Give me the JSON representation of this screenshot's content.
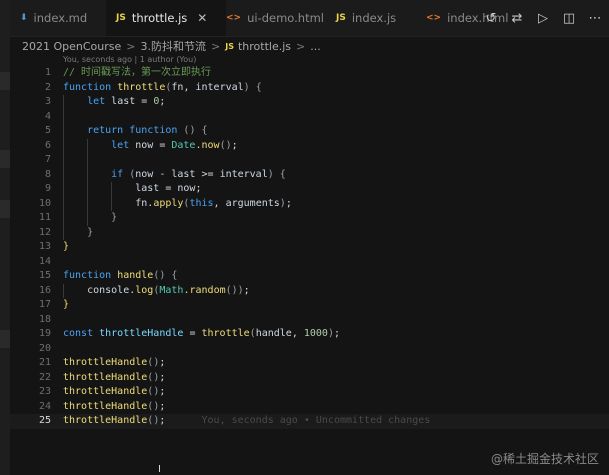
{
  "tabs": [
    {
      "icon": "markdown-icon",
      "glyph": "⬇",
      "label": "index.md",
      "active": false
    },
    {
      "icon": "js-file-icon",
      "glyph": "JS",
      "label": "throttle.js",
      "active": true
    },
    {
      "icon": "html-file-icon",
      "glyph": "<>",
      "label": "ui-demo.html",
      "active": false
    },
    {
      "icon": "js-file-icon",
      "glyph": "JS",
      "label": "index.js",
      "active": false
    },
    {
      "icon": "html-file-icon",
      "glyph": "<>",
      "label": "index.html",
      "active": false
    }
  ],
  "tab_close_glyph": "✕",
  "actions": [
    {
      "name": "history-icon",
      "glyph": "↺"
    },
    {
      "name": "compare-changes-icon",
      "glyph": "⇄"
    },
    {
      "name": "run-icon",
      "glyph": "▷"
    },
    {
      "name": "split-editor-icon",
      "glyph": "◫"
    },
    {
      "name": "more-icon",
      "glyph": "⋯"
    }
  ],
  "breadcrumb": {
    "parts": [
      "2021 OpenCourse",
      "3.防抖和节流"
    ],
    "file_icon": "JS",
    "file": "throttle.js",
    "trail": "...",
    "separator": ">"
  },
  "codelens": "You, seconds ago | 1 author (You)",
  "editor": {
    "current_line": 25,
    "inline_blame": "You, seconds ago • Uncommitted changes",
    "lines": [
      {
        "n": "1",
        "indent": 0,
        "tokens": [
          [
            "c",
            "// 时间戳写法，第一次立即执行"
          ]
        ]
      },
      {
        "n": "2",
        "indent": 0,
        "tokens": [
          [
            "k",
            "function "
          ],
          [
            "f",
            "throttle"
          ],
          [
            "p",
            "("
          ],
          [
            "v",
            "fn"
          ],
          [
            "o",
            ", "
          ],
          [
            "v",
            "interval"
          ],
          [
            "p",
            ") {"
          ]
        ]
      },
      {
        "n": "3",
        "indent": 1,
        "tokens": [
          [
            "k",
            "let "
          ],
          [
            "v",
            "last"
          ],
          [
            "o",
            " = "
          ],
          [
            "num",
            "0"
          ],
          [
            "o",
            ";"
          ]
        ]
      },
      {
        "n": "4",
        "indent": 1,
        "tokens": []
      },
      {
        "n": "5",
        "indent": 1,
        "tokens": [
          [
            "k",
            "return "
          ],
          [
            "k",
            "function "
          ],
          [
            "p",
            "() {"
          ]
        ]
      },
      {
        "n": "6",
        "indent": 2,
        "tokens": [
          [
            "k",
            "let "
          ],
          [
            "v",
            "now"
          ],
          [
            "o",
            " = "
          ],
          [
            "t",
            "Date"
          ],
          [
            "o",
            "."
          ],
          [
            "f",
            "now"
          ],
          [
            "p",
            "()"
          ],
          [
            "o",
            ";"
          ]
        ]
      },
      {
        "n": "7",
        "indent": 2,
        "tokens": []
      },
      {
        "n": "8",
        "indent": 2,
        "tokens": [
          [
            "k",
            "if "
          ],
          [
            "p",
            "("
          ],
          [
            "v",
            "now"
          ],
          [
            "o",
            " - "
          ],
          [
            "v",
            "last"
          ],
          [
            "o",
            " >= "
          ],
          [
            "v",
            "interval"
          ],
          [
            "p",
            ") {"
          ]
        ]
      },
      {
        "n": "9",
        "indent": 3,
        "tokens": [
          [
            "v",
            "last"
          ],
          [
            "o",
            " = "
          ],
          [
            "v",
            "now"
          ],
          [
            "o",
            ";"
          ]
        ]
      },
      {
        "n": "10",
        "indent": 3,
        "tokens": [
          [
            "v",
            "fn"
          ],
          [
            "o",
            "."
          ],
          [
            "f",
            "apply"
          ],
          [
            "p",
            "("
          ],
          [
            "sb",
            "this"
          ],
          [
            "o",
            ", "
          ],
          [
            "v",
            "arguments"
          ],
          [
            "p",
            ")"
          ],
          [
            "o",
            ";"
          ]
        ]
      },
      {
        "n": "11",
        "indent": 2,
        "tokens": [
          [
            "p",
            "}"
          ]
        ]
      },
      {
        "n": "12",
        "indent": 1,
        "tokens": [
          [
            "p",
            "}"
          ]
        ]
      },
      {
        "n": "13",
        "indent": 0,
        "tokens": [
          [
            "f",
            "}"
          ]
        ]
      },
      {
        "n": "14",
        "indent": 0,
        "tokens": []
      },
      {
        "n": "15",
        "indent": 0,
        "tokens": [
          [
            "k",
            "function "
          ],
          [
            "f",
            "handle"
          ],
          [
            "p",
            "() {"
          ]
        ]
      },
      {
        "n": "16",
        "indent": 1,
        "tokens": [
          [
            "v",
            "console"
          ],
          [
            "o",
            "."
          ],
          [
            "f",
            "log"
          ],
          [
            "p",
            "("
          ],
          [
            "t",
            "Math"
          ],
          [
            "o",
            "."
          ],
          [
            "f",
            "random"
          ],
          [
            "p",
            "())"
          ],
          [
            "o",
            ";"
          ]
        ]
      },
      {
        "n": "17",
        "indent": 0,
        "tokens": [
          [
            "f",
            "}"
          ]
        ]
      },
      {
        "n": "18",
        "indent": 0,
        "tokens": []
      },
      {
        "n": "19",
        "indent": 0,
        "tokens": [
          [
            "k",
            "const "
          ],
          [
            "cy",
            "throttleHandle"
          ],
          [
            "o",
            " = "
          ],
          [
            "f",
            "throttle"
          ],
          [
            "p",
            "("
          ],
          [
            "v",
            "handle"
          ],
          [
            "o",
            ", "
          ],
          [
            "num",
            "1000"
          ],
          [
            "p",
            ")"
          ],
          [
            "o",
            ";"
          ]
        ]
      },
      {
        "n": "20",
        "indent": 0,
        "tokens": []
      },
      {
        "n": "21",
        "indent": 0,
        "tokens": [
          [
            "f",
            "throttleHandle"
          ],
          [
            "p",
            "()"
          ],
          [
            "o",
            ";"
          ]
        ]
      },
      {
        "n": "22",
        "indent": 0,
        "tokens": [
          [
            "f",
            "throttleHandle"
          ],
          [
            "p",
            "()"
          ],
          [
            "o",
            ";"
          ]
        ]
      },
      {
        "n": "23",
        "indent": 0,
        "tokens": [
          [
            "f",
            "throttleHandle"
          ],
          [
            "p",
            "()"
          ],
          [
            "o",
            ";"
          ]
        ]
      },
      {
        "n": "24",
        "indent": 0,
        "tokens": [
          [
            "f",
            "throttleHandle"
          ],
          [
            "p",
            "()"
          ],
          [
            "o",
            ";"
          ]
        ]
      },
      {
        "n": "25",
        "indent": 0,
        "tokens": [
          [
            "f",
            "throttleHandle"
          ],
          [
            "p",
            "()"
          ],
          [
            "o",
            ";"
          ]
        ]
      }
    ]
  },
  "watermark": "@稀土掘金技术社区",
  "cursor_glyph": "I"
}
